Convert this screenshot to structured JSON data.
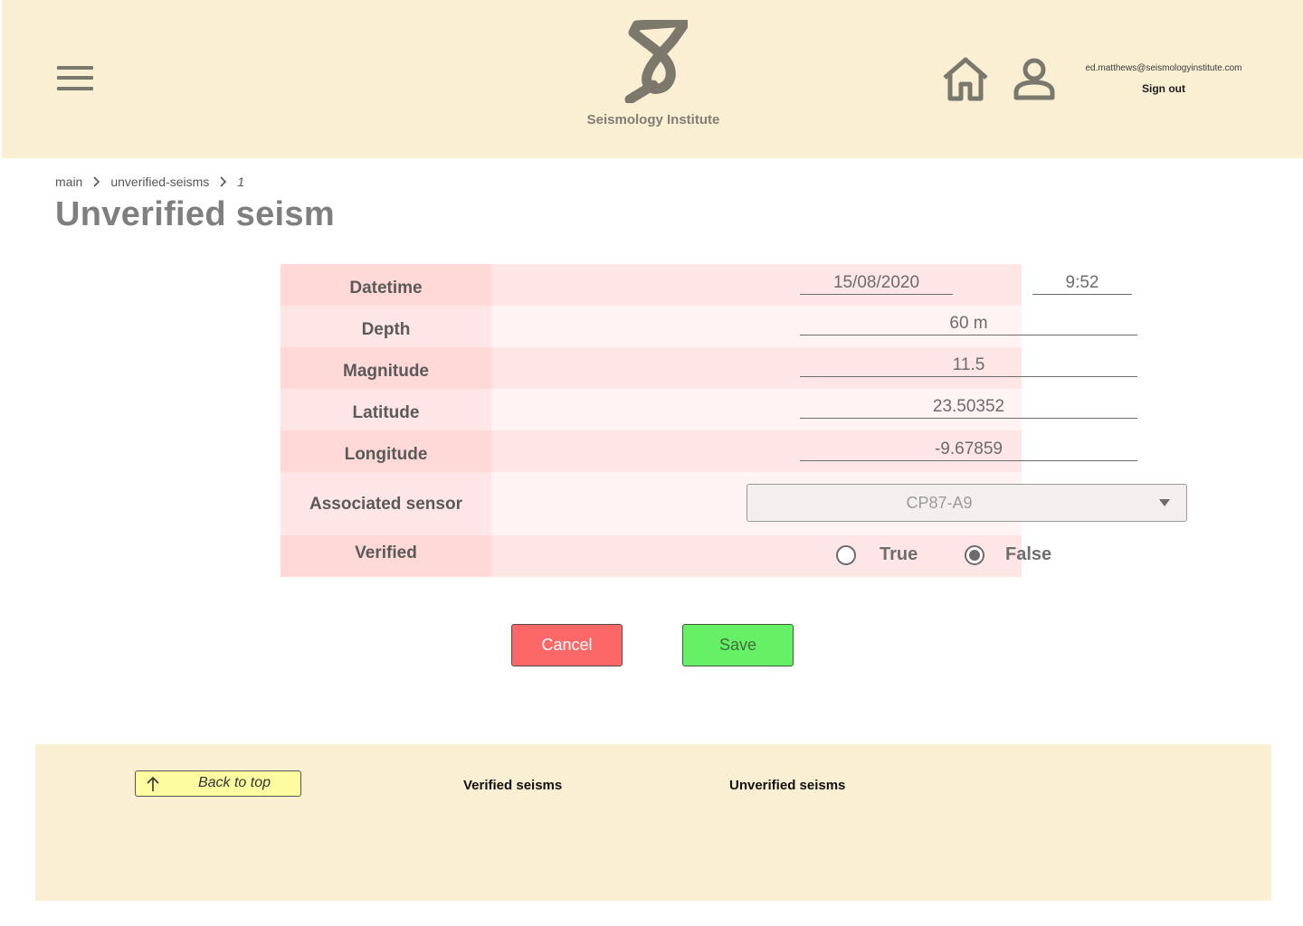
{
  "header": {
    "brand_name": "Seismology Institute",
    "user_email": "ed.matthews@seismologyinstitute.com",
    "sign_out_label": "Sign out",
    "icons": [
      "menu-icon",
      "logo-icon",
      "home-icon",
      "user-icon"
    ]
  },
  "breadcrumb": [
    "main",
    "unverified-seisms",
    "1"
  ],
  "page_title": "Unverified seism",
  "form": {
    "datetime": {
      "label": "Datetime",
      "date": "15/08/2020",
      "time": "9:52"
    },
    "depth": {
      "label": "Depth",
      "value": "60 m"
    },
    "magnitude": {
      "label": "Magnitude",
      "value": "11.5"
    },
    "latitude": {
      "label": "Latitude",
      "value": "23.50352"
    },
    "longitude": {
      "label": "Longitude",
      "value": "-9.67859"
    },
    "sensor": {
      "label": "Associated sensor",
      "selected": "CP87-A9"
    },
    "verified": {
      "label": "Verified",
      "options": [
        "True",
        "False"
      ],
      "selected": "False"
    }
  },
  "actions": {
    "cancel_label": "Cancel",
    "save_label": "Save"
  },
  "footer": {
    "back_to_top_label": "Back to top",
    "links": [
      "Verified seisms",
      "Unverified seisms"
    ]
  },
  "colors": {
    "header_bg": "#faeed3",
    "label_cell": "#ffd8d8",
    "value_cell": "#ffe6e6",
    "cancel": "#fc6868",
    "save": "#65f065",
    "back_to_top": "#fdfca0"
  }
}
